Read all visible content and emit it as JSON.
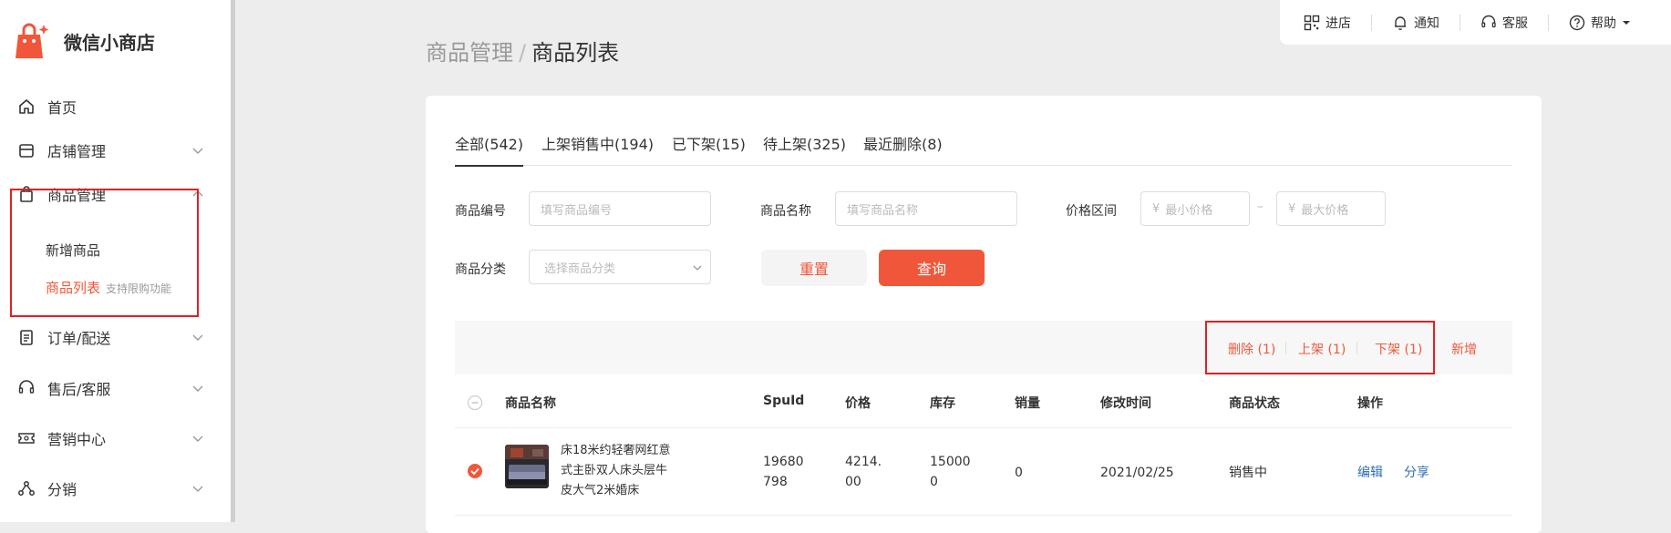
{
  "brand": {
    "name": "微信小商店",
    "accent": "#f0573a"
  },
  "sidebar": {
    "items": [
      {
        "label": "首页",
        "icon": "home-icon"
      },
      {
        "label": "店铺管理",
        "icon": "store-icon"
      },
      {
        "label": "商品管理",
        "icon": "bag-icon"
      },
      {
        "label": "订单/配送",
        "icon": "clipboard-icon"
      },
      {
        "label": "售后/客服",
        "icon": "headset-icon"
      },
      {
        "label": "营销中心",
        "icon": "ticket-icon"
      },
      {
        "label": "分销",
        "icon": "share-nodes-icon"
      }
    ],
    "sub_items": [
      {
        "label": "新增商品"
      },
      {
        "label": "商品列表",
        "tip": "支持限购功能"
      }
    ]
  },
  "topbar": {
    "items": [
      {
        "label": "进店",
        "icon": "qrcode-icon"
      },
      {
        "label": "通知",
        "icon": "bell-icon"
      },
      {
        "label": "客服",
        "icon": "headset-icon"
      },
      {
        "label": "帮助",
        "icon": "help-icon"
      }
    ]
  },
  "breadcrumb": {
    "parent": "商品管理",
    "sep": "/",
    "current": "商品列表"
  },
  "tabs": [
    {
      "label": "全部(542)"
    },
    {
      "label": "上架销售中(194)"
    },
    {
      "label": "已下架(15)"
    },
    {
      "label": "待上架(325)"
    },
    {
      "label": "最近删除(8)"
    }
  ],
  "filters": {
    "code_label": "商品编号",
    "code_placeholder": "填写商品编号",
    "name_label": "商品名称",
    "name_placeholder": "填写商品名称",
    "price_label": "价格区间",
    "currency": "¥",
    "min_placeholder": "最小价格",
    "max_placeholder": "最大价格",
    "range_sep": "–",
    "category_label": "商品分类",
    "category_placeholder": "选择商品分类",
    "reset_label": "重置",
    "query_label": "查询"
  },
  "actions": {
    "delete": "删除 (1)",
    "on_shelf": "上架 (1)",
    "off_shelf": "下架 (1)",
    "add": "新增"
  },
  "table": {
    "headers": {
      "name": "商品名称",
      "spu": "SpuId",
      "price": "价格",
      "stock": "库存",
      "sales": "销量",
      "modified": "修改时间",
      "status": "商品状态",
      "ops": "操作"
    },
    "rows": [
      {
        "name": "床18米约轻奢网红意式主卧双人床头层牛皮大气2米婚床",
        "spu": "19680798",
        "price": "4214.00",
        "stock": "150000",
        "sales": "0",
        "modified": "2021/02/25",
        "status": "销售中",
        "edit": "编辑",
        "share": "分享",
        "selected": true
      }
    ]
  }
}
